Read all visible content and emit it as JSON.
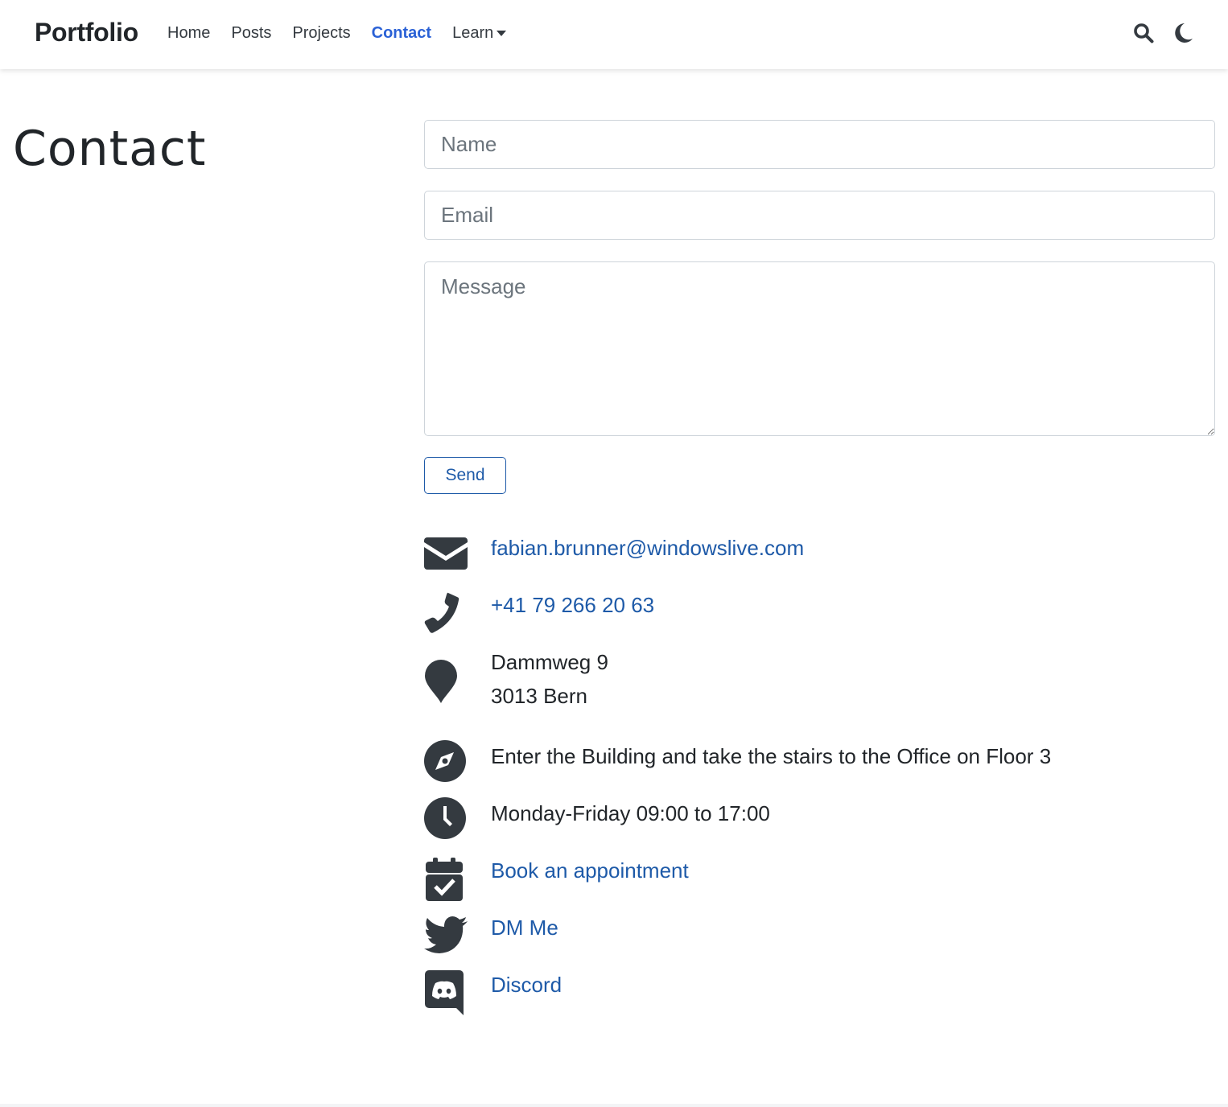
{
  "navbar": {
    "brand": "Portfolio",
    "links": [
      {
        "label": "Home"
      },
      {
        "label": "Posts"
      },
      {
        "label": "Projects"
      },
      {
        "label": "Contact",
        "active": true
      },
      {
        "label": "Learn",
        "dropdown": true
      }
    ],
    "icons": [
      "search-icon",
      "moon-icon"
    ]
  },
  "page": {
    "title": "Contact"
  },
  "form": {
    "name_placeholder": "Name",
    "email_placeholder": "Email",
    "message_placeholder": "Message",
    "send_label": "Send"
  },
  "contact": {
    "email": "fabian.brunner@windowslive.com",
    "phone": "+41 79 266 20 63",
    "address_line1": "Dammweg 9",
    "address_line2": "3013 Bern",
    "directions": "Enter the Building and take the stairs to the Office on Floor 3",
    "hours": "Monday-Friday 09:00 to 17:00",
    "appointment": "Book an appointment",
    "twitter": "DM Me",
    "discord": "Discord"
  },
  "colors": {
    "link": "#1e5aa8",
    "active_nav": "#2a61d6",
    "text": "#212529",
    "icon": "#343a40"
  }
}
